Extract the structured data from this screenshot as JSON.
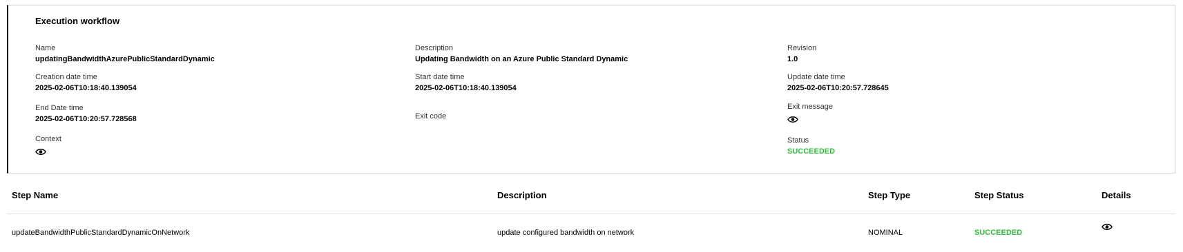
{
  "workflow": {
    "title": "Execution workflow",
    "name_label": "Name",
    "name": "updatingBandwidthAzurePublicStandardDynamic",
    "description_label": "Description",
    "description": "Updating Bandwidth on an Azure Public Standard Dynamic",
    "revision_label": "Revision",
    "revision": "1.0",
    "creation_label": "Creation date time",
    "creation": "2025-02-06T10:18:40.139054",
    "start_label": "Start date time",
    "start": "2025-02-06T10:18:40.139054",
    "update_label": "Update date time",
    "update": "2025-02-06T10:20:57.728645",
    "end_label": "End Date time",
    "end": "2025-02-06T10:20:57.728568",
    "exit_code_label": "Exit code",
    "exit_message_label": "Exit message",
    "context_label": "Context",
    "status_label": "Status",
    "status": "SUCCEEDED",
    "status_color": "#2ebd3a",
    "icons": {
      "exit_message": "eye-icon",
      "context": "eye-icon"
    }
  },
  "steps": {
    "headers": [
      "Step Name",
      "Description",
      "Step Type",
      "Step Status",
      "Details"
    ],
    "rows": [
      {
        "name": "updateBandwidthPublicStandardDynamicOnNetwork",
        "description": "update configured bandwidth on network",
        "type": "NOMINAL",
        "status": "SUCCEEDED",
        "details_icon": "eye-icon"
      }
    ]
  }
}
